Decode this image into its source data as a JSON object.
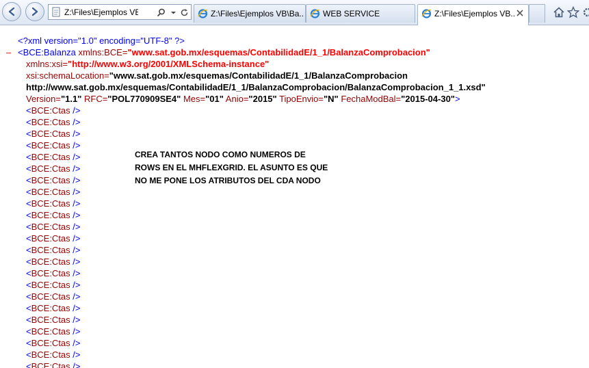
{
  "browser": {
    "address_url": "Z:\\Files\\Ejemplos VB\\Bal",
    "tabs": [
      {
        "label": "Z:\\Files\\Ejemplos VB\\Ba...",
        "active": false
      },
      {
        "label": "WEB SERVICE",
        "active": false
      },
      {
        "label": "Z:\\Files\\Ejemplos VB...",
        "active": true
      }
    ]
  },
  "xml": {
    "declaration": "<?xml version=\"1.0\" encoding=\"UTF-8\" ?>",
    "collapse_symbol": "–",
    "root_open": "<BCE:Balanza",
    "attr_xmlns_bce_name": "xmlns:BCE=",
    "attr_xmlns_bce_value": "\"www.sat.gob.mx/esquemas/ContabilidadE/1_1/BalanzaComprobacion\"",
    "attr_xmlns_xsi_name": "xmlns:xsi=",
    "attr_xmlns_xsi_value": "\"http://www.w3.org/2001/XMLSchema-instance\"",
    "attr_schema_name": "xsi:schemaLocation=",
    "attr_schema_value_1": "\"www.sat.gob.mx/esquemas/ContabilidadE/1_1/BalanzaComprobacion",
    "attr_schema_value_2": "http://www.sat.gob.mx/esquemas/ContabilidadE/1_1/BalanzaComprobacion/BalanzaComprobacion_1_1.xsd\"",
    "attr_version_name": "Version=",
    "attr_version_value": "\"1.1\"",
    "attr_rfc_name": "RFC=",
    "attr_rfc_value": "\"POL770909SE4\"",
    "attr_mes_name": "Mes=",
    "attr_mes_value": "\"01\"",
    "attr_anio_name": "Anio=",
    "attr_anio_value": "\"2015\"",
    "attr_tipo_name": "TipoEnvio=",
    "attr_tipo_value": "\"N\"",
    "attr_fecha_name": "FechaModBal=",
    "attr_fecha_value": "\"2015-04-30\"",
    "close_bracket": ">",
    "child_open": "<",
    "child_name": "BCE:Ctas",
    "child_close": " />"
  },
  "note": {
    "line1": "CREA TANTOS NODO COMO NUMEROS DE",
    "line2": "ROWS EN EL MHFLEXGRID. EL ASUNTO ES QUE",
    "line3": "NO ME PONE LOS ATRIBUTOS DEL CDA NODO"
  }
}
